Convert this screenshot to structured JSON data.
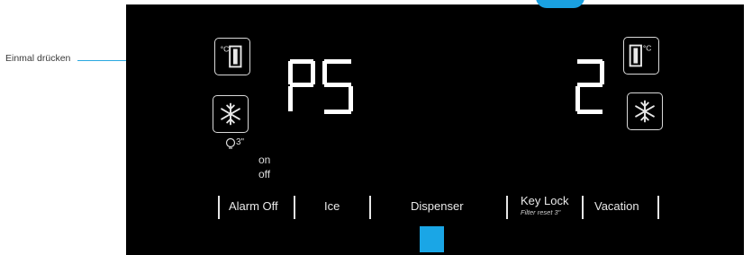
{
  "callout": {
    "text": "Einmal drücken"
  },
  "display": {
    "left_code": "P5",
    "right_code": "2",
    "on_label": "on",
    "off_label": "off",
    "timer_label": "3\""
  },
  "buttons": {
    "alarm_off": "Alarm Off",
    "ice": "Ice",
    "dispenser": "Dispenser",
    "key_lock": "Key Lock",
    "key_lock_sub": "Filter reset 3\"",
    "vacation": "Vacation"
  },
  "colors": {
    "accent": "#1aa6e6",
    "panel": "#000000",
    "segment": "#ffffff"
  },
  "icons": [
    "fridge-temp-icon",
    "freeze-icon",
    "fridge-temp-right-icon",
    "freeze-right-icon",
    "bulb-timer-icon"
  ]
}
